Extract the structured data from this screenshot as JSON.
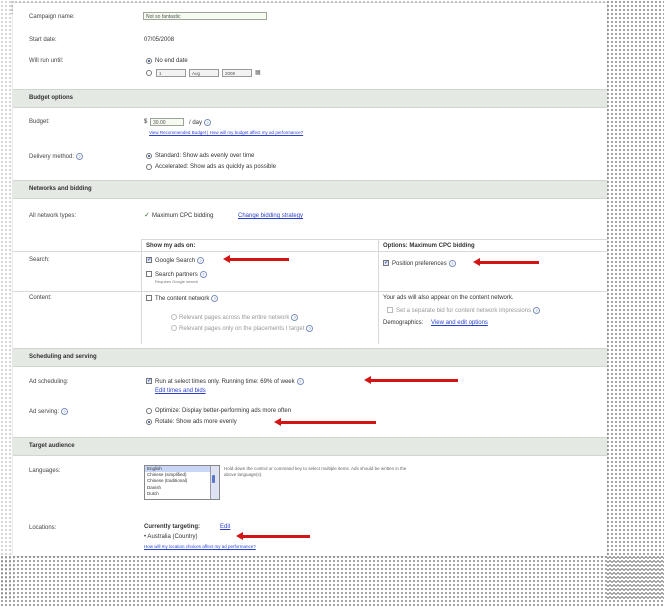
{
  "general": {
    "campaign_name_label": "Campaign name:",
    "campaign_name_value": "Not so fantastic",
    "start_date_label": "Start date:",
    "start_date_value": "07/05/2008",
    "will_run_until_label": "Will run until:",
    "no_end_date": "No end date",
    "end_date_day": "1",
    "end_date_month": "Aug",
    "end_date_year": "2008"
  },
  "budget": {
    "section_title": "Budget options",
    "budget_label": "Budget:",
    "currency": "$",
    "budget_value": "30.00",
    "per_day": "/ day",
    "budget_link": "View Recommended Budget | How will my budget affect my ad performance?",
    "delivery_label": "Delivery method:",
    "delivery_standard": "Standard: Show ads evenly over time",
    "delivery_accelerated": "Accelerated: Show ads as quickly as possible"
  },
  "networks": {
    "section_title": "Networks and bidding",
    "all_network_types_label": "All network types:",
    "bidding_value": "Maximum CPC bidding",
    "change_bidding_link": "Change bidding strategy",
    "show_ads_on_header": "Show my ads on:",
    "options_header": "Options: Maximum CPC bidding",
    "search_label": "Search:",
    "google_search": "Google Search",
    "search_partners": "Search partners",
    "search_partners_sub": "Requires Google search",
    "position_preferences": "Position preferences",
    "content_label": "Content:",
    "content_network": "The content network",
    "relevant_entire": "Relevant pages across the entire network",
    "relevant_placements": "Relevant pages only on the placements I target",
    "content_note": "Your ads will also appear on the content network.",
    "separate_bid": "Set a separate bid for content network impressions",
    "demographics_label": "Demographics:",
    "demographics_link": "View and edit options"
  },
  "scheduling": {
    "section_title": "Scheduling and serving",
    "ad_scheduling_label": "Ad scheduling:",
    "ad_scheduling_value": "Run at select times only. Running time: 69% of week",
    "edit_times_link": "Edit times and bids",
    "ad_serving_label": "Ad serving:",
    "optimize": "Optimize: Display better-performing ads more often",
    "rotate": "Rotate: Show ads more evenly"
  },
  "audience": {
    "section_title": "Target audience",
    "languages_label": "Languages:",
    "languages": [
      "English",
      "Chinese (simplified)",
      "Chinese (traditional)",
      "Danish",
      "Dutch"
    ],
    "languages_hint": "Hold down the control or command key to select multiple items. Ads should be written in the above language(s).",
    "locations_label": "Locations:",
    "currently_targeting": "Currently targeting:",
    "edit_link": "Edit",
    "location_value": "• Australia (Country)",
    "location_help_link": "How will my location choices affect my ad performance?"
  },
  "colors": {
    "section_bg": "#e4e9e4",
    "arrow": "#d21414",
    "link": "#2a3fd0"
  }
}
